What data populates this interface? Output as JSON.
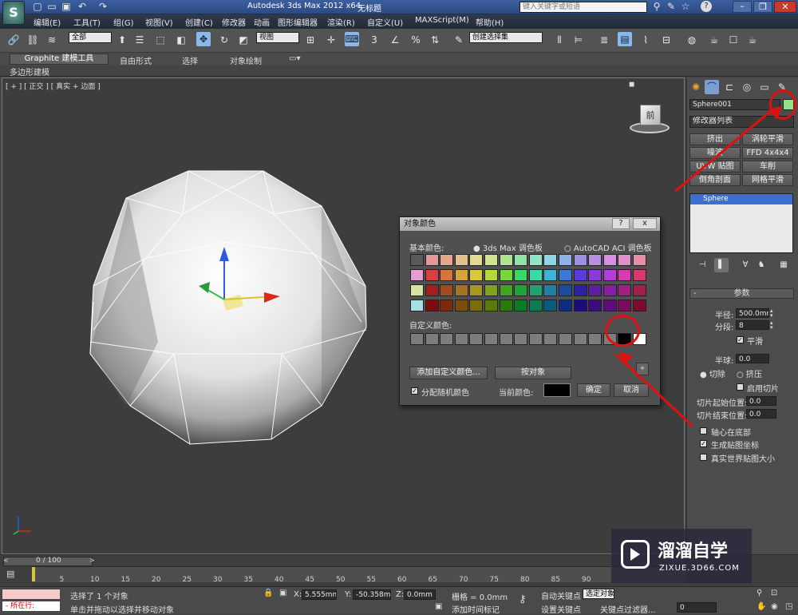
{
  "titlebar": {
    "app_title": "Autodesk 3ds Max  2012  x64",
    "doc_title": "无标题",
    "search_placeholder": "键入关键字或短语",
    "help_label": "?"
  },
  "menu": [
    "编辑(E)",
    "工具(T)",
    "组(G)",
    "视图(V)",
    "创建(C)",
    "修改器",
    "动画",
    "图形编辑器",
    "渲染(R)",
    "自定义(U)",
    "MAXScript(M)",
    "帮助(H)"
  ],
  "toolbar": {
    "selection_filter": "全部",
    "ref_coord": "视图",
    "named_selection": "创建选择集",
    "snap_labels": [
      "3",
      "%"
    ]
  },
  "ribbon": {
    "tabs": [
      "Graphite 建模工具",
      "自由形式",
      "选择",
      "对象绘制"
    ],
    "sub_label": "多边形建模"
  },
  "viewport": {
    "label": "[ + ] [ 正交 ] [ 真实 + 边面 ]",
    "cube_face": "前"
  },
  "dialog": {
    "title": "对象颜色",
    "help": "?",
    "close": "x",
    "basic_colors_label": "基本颜色:",
    "palette_3dsmax": "3ds Max 调色板",
    "palette_autocad": "AutoCAD ACI 调色板",
    "custom_colors_label": "自定义颜色:",
    "add_custom_button": "添加自定义颜色...",
    "by_object_button": "按对象",
    "random_colors_label": "分配随机颜色",
    "current_color_label": "当前颜色:",
    "ok_button": "确定",
    "cancel_button": "取消",
    "current_color": "#000000",
    "basic_colors": [
      [
        "#595959",
        "#e39999",
        "#e3a68f",
        "#e3c18f",
        "#e3d98f",
        "#d2e38f",
        "#aee38f",
        "#8fe3a6",
        "#8fe3c6",
        "#8fd5e3",
        "#8fb1e3",
        "#9e8fe3",
        "#b98fe3",
        "#d88fe3",
        "#e38fc8",
        "#e38fa7"
      ],
      [
        "#e39ed6",
        "#d93f3f",
        "#d9733a",
        "#d9a23a",
        "#d9c93a",
        "#b5d93a",
        "#75d93a",
        "#3ad966",
        "#3ad9a5",
        "#3ab5d9",
        "#3a78d9",
        "#5a3ad9",
        "#8a3ad9",
        "#b83ad9",
        "#d93ab0",
        "#d93a6e"
      ],
      [
        "#d6e3a1",
        "#a31f1f",
        "#a34a1f",
        "#a3741f",
        "#a3991f",
        "#7fa31f",
        "#43a31f",
        "#1fa33c",
        "#1fa373",
        "#1f80a3",
        "#1f4aa3",
        "#2e1fa3",
        "#5b1fa3",
        "#871fa3",
        "#a31f80",
        "#a31f46"
      ],
      [
        "#a6e0e3",
        "#7a0d0d",
        "#7a2a0d",
        "#7a4c0d",
        "#7a6d0d",
        "#5a7a0d",
        "#2a7a0d",
        "#0d7a25",
        "#0d7a52",
        "#0d5a7a",
        "#0d2e7a",
        "#1a0d7a",
        "#3c0d7a",
        "#5f0d7a",
        "#7a0d5a",
        "#7a0d2e"
      ]
    ],
    "custom_colors": [
      "#7d7d7d",
      "#7d7d7d",
      "#7d7d7d",
      "#7d7d7d",
      "#7d7d7d",
      "#7d7d7d",
      "#7d7d7d",
      "#7d7d7d",
      "#7d7d7d",
      "#7d7d7d",
      "#7d7d7d",
      "#7d7d7d",
      "#7d7d7d",
      "#7d7d7d",
      "#000000",
      "#ffffff"
    ]
  },
  "cmdpanel": {
    "object_name": "Sphere001",
    "object_color": "#8fe38f",
    "modifier_list": "修改器列表",
    "mod_buttons": [
      "挤出",
      "涡轮平滑",
      "噪波",
      "FFD 4x4x4",
      "UVW 贴图",
      "车削",
      "倒角剖面",
      "网格平滑"
    ],
    "stack_item": "Sphere",
    "params_title": "参数",
    "radius_label": "半径:",
    "radius_value": "500.0mm",
    "segments_label": "分段:",
    "segments_value": "8",
    "smooth_label": "平滑",
    "hemisphere_label": "半球:",
    "hemisphere_value": "0.0",
    "chop_label": "切除",
    "squash_label": "挤压",
    "slice_on_label": "启用切片",
    "slice_from_label": "切片起始位置:",
    "slice_from_value": "0.0",
    "slice_to_label": "切片结束位置:",
    "slice_to_value": "0.0",
    "base_pivot_label": "轴心在底部",
    "gen_mapping_label": "生成贴图坐标",
    "real_world_label": "真实世界贴图大小"
  },
  "timeline": {
    "frame_counter": "0 / 100",
    "ticks": [
      "5",
      "10",
      "15",
      "20",
      "25",
      "30",
      "35",
      "40",
      "45",
      "50",
      "55",
      "60",
      "65",
      "70",
      "75",
      "80",
      "85",
      "90"
    ],
    "frame_progress": 0.0
  },
  "status": {
    "prompt_label": "所在行:",
    "selection_text": "选择了 1 个对象",
    "hint_text": "单击并拖动以选择并移动对象",
    "x_label": "X:",
    "x_value": "5.555mm",
    "y_label": "Y:",
    "y_value": "-50.358mm",
    "z_label": "Z:",
    "z_value": "0.0mm",
    "grid_text": "栅格 = 0.0mm",
    "add_time_tag": "添加时间标记",
    "auto_key": "自动关键点",
    "set_key": "设置关键点",
    "selected_label": "选定对象",
    "key_filters": "关键点过滤器...",
    "frame_value": "0"
  },
  "watermark": {
    "brand": "溜溜自学",
    "url": "ZIXUE.3D66.COM"
  }
}
